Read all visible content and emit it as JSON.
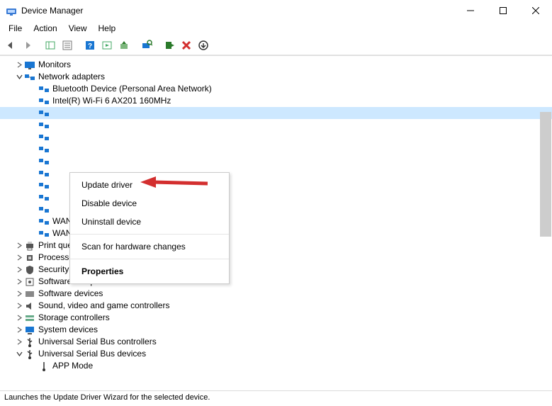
{
  "window": {
    "title": "Device Manager"
  },
  "menu": {
    "file": "File",
    "action": "Action",
    "view": "View",
    "help": "Help"
  },
  "tree": {
    "monitors": "Monitors",
    "network_adapters": "Network adapters",
    "na_items": {
      "bluetooth": "Bluetooth Device (Personal Area Network)",
      "wifi": "Intel(R) Wi-Fi 6 AX201 160MHz",
      "realtek_partial": "",
      "wan_pptp": "WAN Miniport (PPTP)",
      "wan_sstp": "WAN Miniport (SSTP)"
    },
    "print_queues": "Print queues",
    "processors": "Processors",
    "security_devices": "Security devices",
    "software_components": "Software components",
    "software_devices": "Software devices",
    "sound": "Sound, video and game controllers",
    "storage_controllers": "Storage controllers",
    "system_devices": "System devices",
    "usb_controllers": "Universal Serial Bus controllers",
    "usb_devices": "Universal Serial Bus devices",
    "app_mode": "APP Mode"
  },
  "context_menu": {
    "update": "Update driver",
    "disable": "Disable device",
    "uninstall": "Uninstall device",
    "scan": "Scan for hardware changes",
    "properties": "Properties"
  },
  "status": "Launches the Update Driver Wizard for the selected device."
}
